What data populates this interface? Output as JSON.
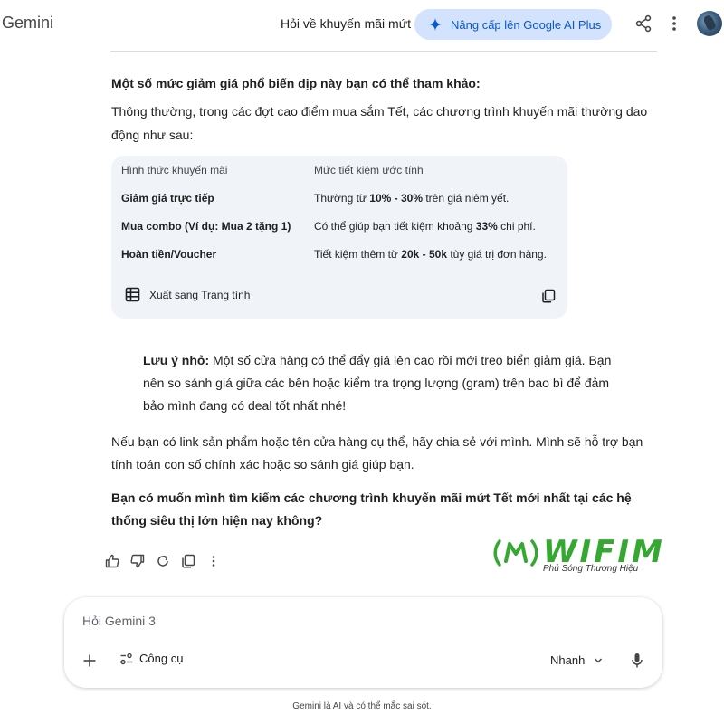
{
  "header": {
    "brand": "Gemini",
    "conversation_title": "Hỏi về khuyến mãi mứt",
    "upgrade_label": "Nâng cấp lên Google AI Plus"
  },
  "response": {
    "heading": "Một số mức giảm giá phổ biến dịp này bạn có thể tham khảo:",
    "intro": "Thông thường, trong các đợt cao điểm mua sắm Tết, các chương trình khuyến mãi thường dao động như sau:",
    "table": {
      "headers": [
        "Hình thức khuyến mãi",
        "Mức tiết kiệm ước tính"
      ],
      "rows": [
        {
          "type": "Giảm giá trực tiếp",
          "pre": "Thường từ ",
          "bold": "10% - 30%",
          "post": " trên giá niêm yết."
        },
        {
          "type": "Mua combo (Ví dụ: Mua 2 tặng 1)",
          "pre": "Có thể giúp bạn tiết kiệm khoảng ",
          "bold": "33%",
          "post": " chi phí."
        },
        {
          "type": "Hoàn tiền/Voucher",
          "pre": "Tiết kiệm thêm từ ",
          "bold": "20k - 50k",
          "post": " tùy giá trị đơn hàng."
        }
      ],
      "export_label": "Xuất sang Trang tính"
    },
    "note_label": "Lưu ý nhỏ:",
    "note_text": " Một số cửa hàng có thể đẩy giá lên cao rồi mới treo biển giảm giá. Bạn nên so sánh giá giữa các bên hoặc kiểm tra trọng lượng (gram) trên bao bì để đảm bảo mình đang có deal tốt nhất nhé!",
    "follow_up": "Nếu bạn có link sản phẩm hoặc tên cửa hàng cụ thể, hãy chia sẻ với mình. Mình sẽ hỗ trợ bạn tính toán con số chính xác hoặc so sánh giá giúp bạn.",
    "question": "Bạn có muốn mình tìm kiếm các chương trình khuyến mãi mứt Tết mới nhất tại các hệ thống siêu thị lớn hiện nay không?"
  },
  "watermark": {
    "word": "WIFIM",
    "tagline": "Phủ Sóng Thương Hiệu"
  },
  "composer": {
    "placeholder": "Hỏi Gemini 3",
    "tools_label": "Công cụ",
    "mode_label": "Nhanh"
  },
  "footer": "Gemini là AI và có thể mắc sai sót.",
  "colors": {
    "accent": "#0b57d0",
    "upgrade_bg": "#d3e3fd",
    "table_bg": "#f0f4f9",
    "watermark_green": "#35a832"
  },
  "icons": [
    "spark-icon",
    "share-icon",
    "more-vert-icon",
    "table-icon",
    "copy-icon",
    "thumb-up-icon",
    "thumb-down-icon",
    "redo-icon",
    "copy-icon",
    "more-vert-icon",
    "plus-icon",
    "tools-icon",
    "chevron-down-icon",
    "mic-icon"
  ]
}
